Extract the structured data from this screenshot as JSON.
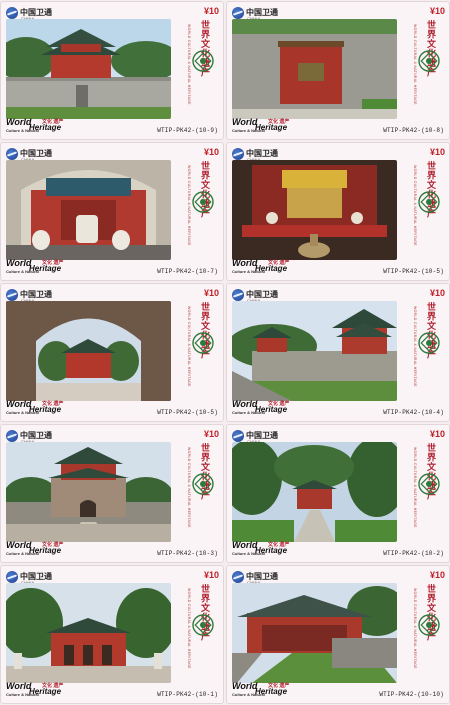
{
  "brand": {
    "name_cn": "中国卫通",
    "name_en": "CHINA SATCOM",
    "icon": "globe-logo-icon"
  },
  "card_text": {
    "price": "¥10",
    "side_cn": "世界文化遗产",
    "side_en": "WORLD CULTURAL & NATURAL HERITAGE",
    "heritage_word1": "World",
    "heritage_word2": "Heritage",
    "heritage_sub": "Culture & Natural",
    "heritage_cn": "文化 遗产"
  },
  "cards": [
    {
      "code": "WTIP-PK42-(10-9)",
      "scene": "pavilion-on-wall"
    },
    {
      "code": "WTIP-PK42-(10-8)",
      "scene": "screen-wall"
    },
    {
      "code": "WTIP-PK42-(10-7)",
      "scene": "altar-vessels"
    },
    {
      "code": "WTIP-PK42-(10-5)",
      "scene": "interior-altar"
    },
    {
      "code": "WTIP-PK42-(10-5)",
      "scene": "tunnel-gate"
    },
    {
      "code": "WTIP-PK42-(10-4)",
      "scene": "tower-on-wall"
    },
    {
      "code": "WTIP-PK42-(10-3)",
      "scene": "tower-gate"
    },
    {
      "code": "WTIP-PK42-(10-2)",
      "scene": "tree-avenue"
    },
    {
      "code": "WTIP-PK42-(10-1)",
      "scene": "red-gatehouse"
    },
    {
      "code": "WTIP-PK42-(10-10)",
      "scene": "courtyard-hall"
    }
  ]
}
